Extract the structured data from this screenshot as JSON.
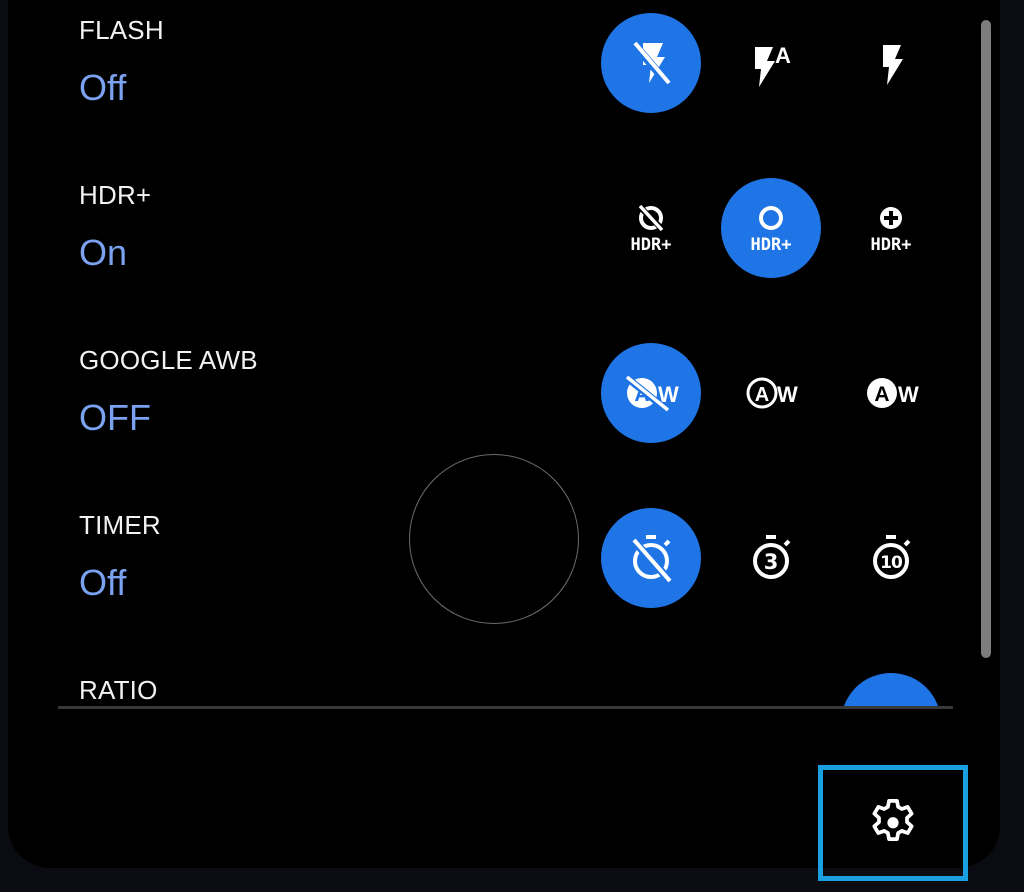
{
  "accent_color": "#1f75e6",
  "value_color": "#7aa2f0",
  "highlight_color": "#1a9fe0",
  "settings_rows": [
    {
      "label": "FLASH",
      "value": "Off",
      "options": [
        {
          "icon": "flash-off-icon",
          "selected": true
        },
        {
          "icon": "flash-auto-icon",
          "badge": "A",
          "selected": false
        },
        {
          "icon": "flash-on-icon",
          "selected": false
        }
      ]
    },
    {
      "label": "HDR+",
      "value": "On",
      "options": [
        {
          "icon": "hdr-off-icon",
          "caption": "HDR+",
          "selected": false
        },
        {
          "icon": "hdr-on-icon",
          "caption": "HDR+",
          "selected": true
        },
        {
          "icon": "hdr-enhanced-icon",
          "caption": "HDR+",
          "selected": false
        }
      ]
    },
    {
      "label": "GOOGLE AWB",
      "value": "OFF",
      "options": [
        {
          "icon": "awb-off-icon",
          "glyph": "A",
          "suffix": "W",
          "selected": true
        },
        {
          "icon": "awb-outline-icon",
          "glyph": "A",
          "suffix": "W",
          "selected": false
        },
        {
          "icon": "awb-filled-icon",
          "glyph": "A",
          "suffix": "W",
          "selected": false
        }
      ]
    },
    {
      "label": "TIMER",
      "value": "Off",
      "options": [
        {
          "icon": "timer-off-icon",
          "selected": true
        },
        {
          "icon": "timer-3-icon",
          "digits": "3",
          "selected": false
        },
        {
          "icon": "timer-10-icon",
          "digits": "10",
          "selected": false
        }
      ]
    },
    {
      "label": "RATIO",
      "value": "",
      "options": [
        {
          "icon": "ratio-tall-icon",
          "selected": false
        },
        {
          "icon": "ratio-wide-icon",
          "selected": true
        }
      ]
    }
  ],
  "settings_button": {
    "icon": "gear-icon"
  }
}
